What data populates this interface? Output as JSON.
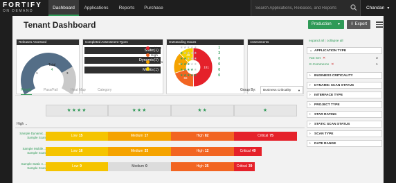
{
  "nav": {
    "logo_line1": "FORTIFY",
    "logo_line2": "ON DEMAND",
    "tabs": [
      "Dashboard",
      "Applications",
      "Reports",
      "Purchase"
    ],
    "search_placeholder": "Search Applications, Releases, and Reports",
    "user": "Chandan"
  },
  "header": {
    "title": "Tenant Dashboard",
    "env_button": "Production",
    "export_button": "Export"
  },
  "widgets": {
    "releases": {
      "title": "Releases Assessed",
      "total_label": "Total",
      "total": "4",
      "left_value": "1",
      "right_value": "3",
      "colors": {
        "assessed": "#546e87",
        "not_assessed": "#c9c9c9"
      }
    },
    "types": {
      "title": "Completed Assessment Types",
      "rows": [
        "Static(1)",
        "Dynamic(1)",
        "Mobile(1)"
      ]
    },
    "issues": {
      "title": "Outstanding Issues",
      "legend": [
        {
          "label": "Critical",
          "color": "#e5212a"
        },
        {
          "label": "High",
          "color": "#f26522"
        },
        {
          "label": "Medium",
          "color": "#f5a300"
        },
        {
          "label": "Low",
          "color": "#f5d100"
        }
      ],
      "slices": [
        {
          "label": "Critical",
          "value": 161,
          "color": "#e5212a"
        },
        {
          "label": "High",
          "value": 66,
          "color": "#f26522"
        },
        {
          "label": "Medium",
          "value": 57,
          "color": "#f5a300"
        },
        {
          "label": "Low",
          "value": 40,
          "color": "#f5d100"
        }
      ],
      "pie_labels": [
        "161",
        "66",
        "57",
        "40"
      ]
    },
    "assessments": {
      "title": "Assessments",
      "rows": [
        {
          "stars": "★★★★★",
          "filled": 0,
          "count": "1"
        },
        {
          "stars": "★★★★★",
          "filled": 1,
          "count": "3"
        },
        {
          "stars": "★★★★★",
          "filled": 2,
          "count": "0"
        },
        {
          "stars": "★★★★★",
          "filled": 3,
          "count": "0"
        },
        {
          "stars": "★★★★★",
          "filled": 4,
          "count": "0"
        },
        {
          "stars": "★★★★★",
          "filled": 5,
          "count": "0"
        }
      ]
    }
  },
  "tabs": [
    "Priority",
    "Pass/Fail",
    "Heat Map",
    "Category"
  ],
  "group_by": {
    "label": "Group By:",
    "value": "Business Criticality"
  },
  "star_columns": [
    "★★★★",
    "★★★",
    "★★",
    "★"
  ],
  "group_label": "High",
  "rows": [
    {
      "name_line1": "Sample Dynamic...",
      "name_line2": "Sample Scan",
      "segments": [
        {
          "label": "Low",
          "value": "15",
          "color": "#f5c400"
        },
        {
          "label": "Medium",
          "value": "17",
          "color": "#f5a300"
        },
        {
          "label": "High",
          "value": "82",
          "color": "#f26522"
        },
        {
          "label": "Critical",
          "value": "75",
          "color": "#e5212a"
        }
      ]
    },
    {
      "name_line1": "Sample Mobile...",
      "name_line2": "Sample Scan",
      "segments": [
        {
          "label": "Low",
          "value": "16",
          "color": "#f5c400"
        },
        {
          "label": "Medium",
          "value": "33",
          "color": "#f5a300"
        },
        {
          "label": "High",
          "value": "12",
          "color": "#f26522"
        },
        {
          "label": "Critical",
          "value": "49",
          "color": "#e5212a"
        }
      ]
    },
    {
      "name_line1": "Sample Static A...",
      "name_line2": "Sample Scan",
      "segments": [
        {
          "label": "Low",
          "value": "9",
          "color": "#f5c400"
        },
        {
          "label": "Medium",
          "value": "0",
          "color": "#dcdcdc"
        },
        {
          "label": "High",
          "value": "25",
          "color": "#f26522"
        },
        {
          "label": "Critical",
          "value": "39",
          "color": "#e5212a"
        }
      ]
    }
  ],
  "filters": {
    "expand_all": "expand all",
    "collapse_all": "collapse all",
    "items": [
      "APPLICATION TYPE",
      "BUSINESS CRITICALITY",
      "DYNAMIC SCAN STATUS",
      "INTERFACE TYPE",
      "PROJECT TYPE",
      "STAR RATING",
      "STATIC SCAN STATUS",
      "SCAN TYPE",
      "DATE RANGE"
    ],
    "app_type_options": [
      {
        "label": "Not Set",
        "count": "3"
      },
      {
        "label": "E-Commerce",
        "count": "1"
      }
    ]
  }
}
